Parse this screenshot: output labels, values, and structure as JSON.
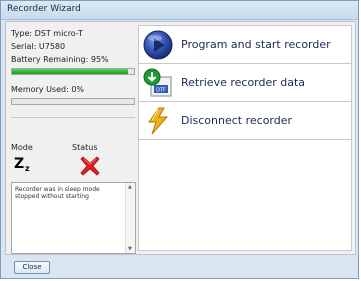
{
  "window": {
    "title": "Recorder Wizard"
  },
  "info": {
    "type_line": "Type: DST micro-T",
    "serial_line": "Serial: U7580",
    "battery_line": "Battery Remaining: 95%",
    "battery_fraction": 0.95,
    "memory_line": "Memory Used: 0%",
    "memory_fraction": 0.0
  },
  "mode": {
    "label": "Mode",
    "icon": "sleep-z-icon",
    "glyph_big": "Z",
    "glyph_small": "z"
  },
  "status": {
    "label": "Status",
    "icon": "error-x-icon",
    "color": "#e02020"
  },
  "notes": {
    "text": "Recorder was in sleep mode stopped without starting"
  },
  "actions": [
    {
      "label": "Program and start recorder",
      "icon": "play-icon"
    },
    {
      "label": "Retrieve recorder data",
      "icon": "download-data-icon"
    },
    {
      "label": "Disconnect recorder",
      "icon": "lightning-disconnect-icon"
    }
  ],
  "footer": {
    "close_label": "Close"
  },
  "colors": {
    "battery_fill": "#16a016",
    "action_text": "#1b2a55",
    "play_blue": "#2f4fb0"
  }
}
